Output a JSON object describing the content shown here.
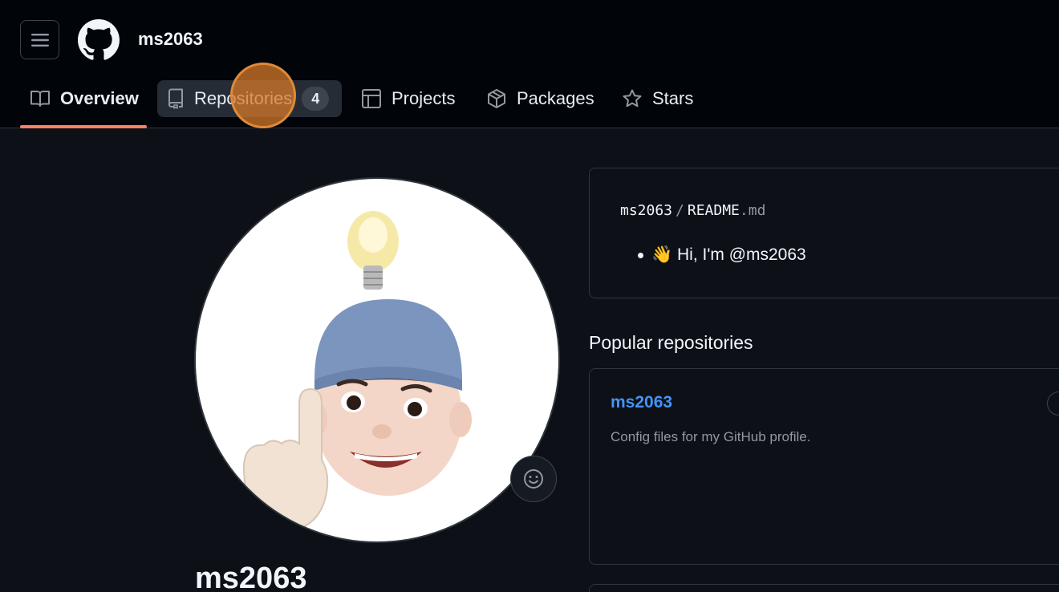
{
  "header": {
    "username": "ms2063",
    "icons": {
      "menu": "hamburger-icon",
      "logo": "github-mark-icon"
    }
  },
  "tabs": [
    {
      "label": "Overview",
      "icon": "book-icon",
      "active": true
    },
    {
      "label": "Repositories",
      "icon": "repo-icon",
      "count": "4"
    },
    {
      "label": "Projects",
      "icon": "table-icon"
    },
    {
      "label": "Packages",
      "icon": "package-icon"
    },
    {
      "label": "Stars",
      "icon": "star-icon"
    }
  ],
  "profile": {
    "name": "ms2063",
    "avatar": "memoji-avatar",
    "status_icon": "smiley-icon"
  },
  "readme": {
    "owner": "ms2063",
    "separator": "/",
    "file_base": "README",
    "file_ext": ".md",
    "items": [
      "👋 Hi, I'm @ms2063"
    ]
  },
  "popular": {
    "title": "Popular repositories",
    "repos": [
      {
        "name": "ms2063",
        "description": "Config files for my GitHub profile."
      }
    ]
  },
  "colors": {
    "accent_underline": "#f78166",
    "link": "#4493f8",
    "background": "#0d1117",
    "header_bg": "#010409"
  }
}
